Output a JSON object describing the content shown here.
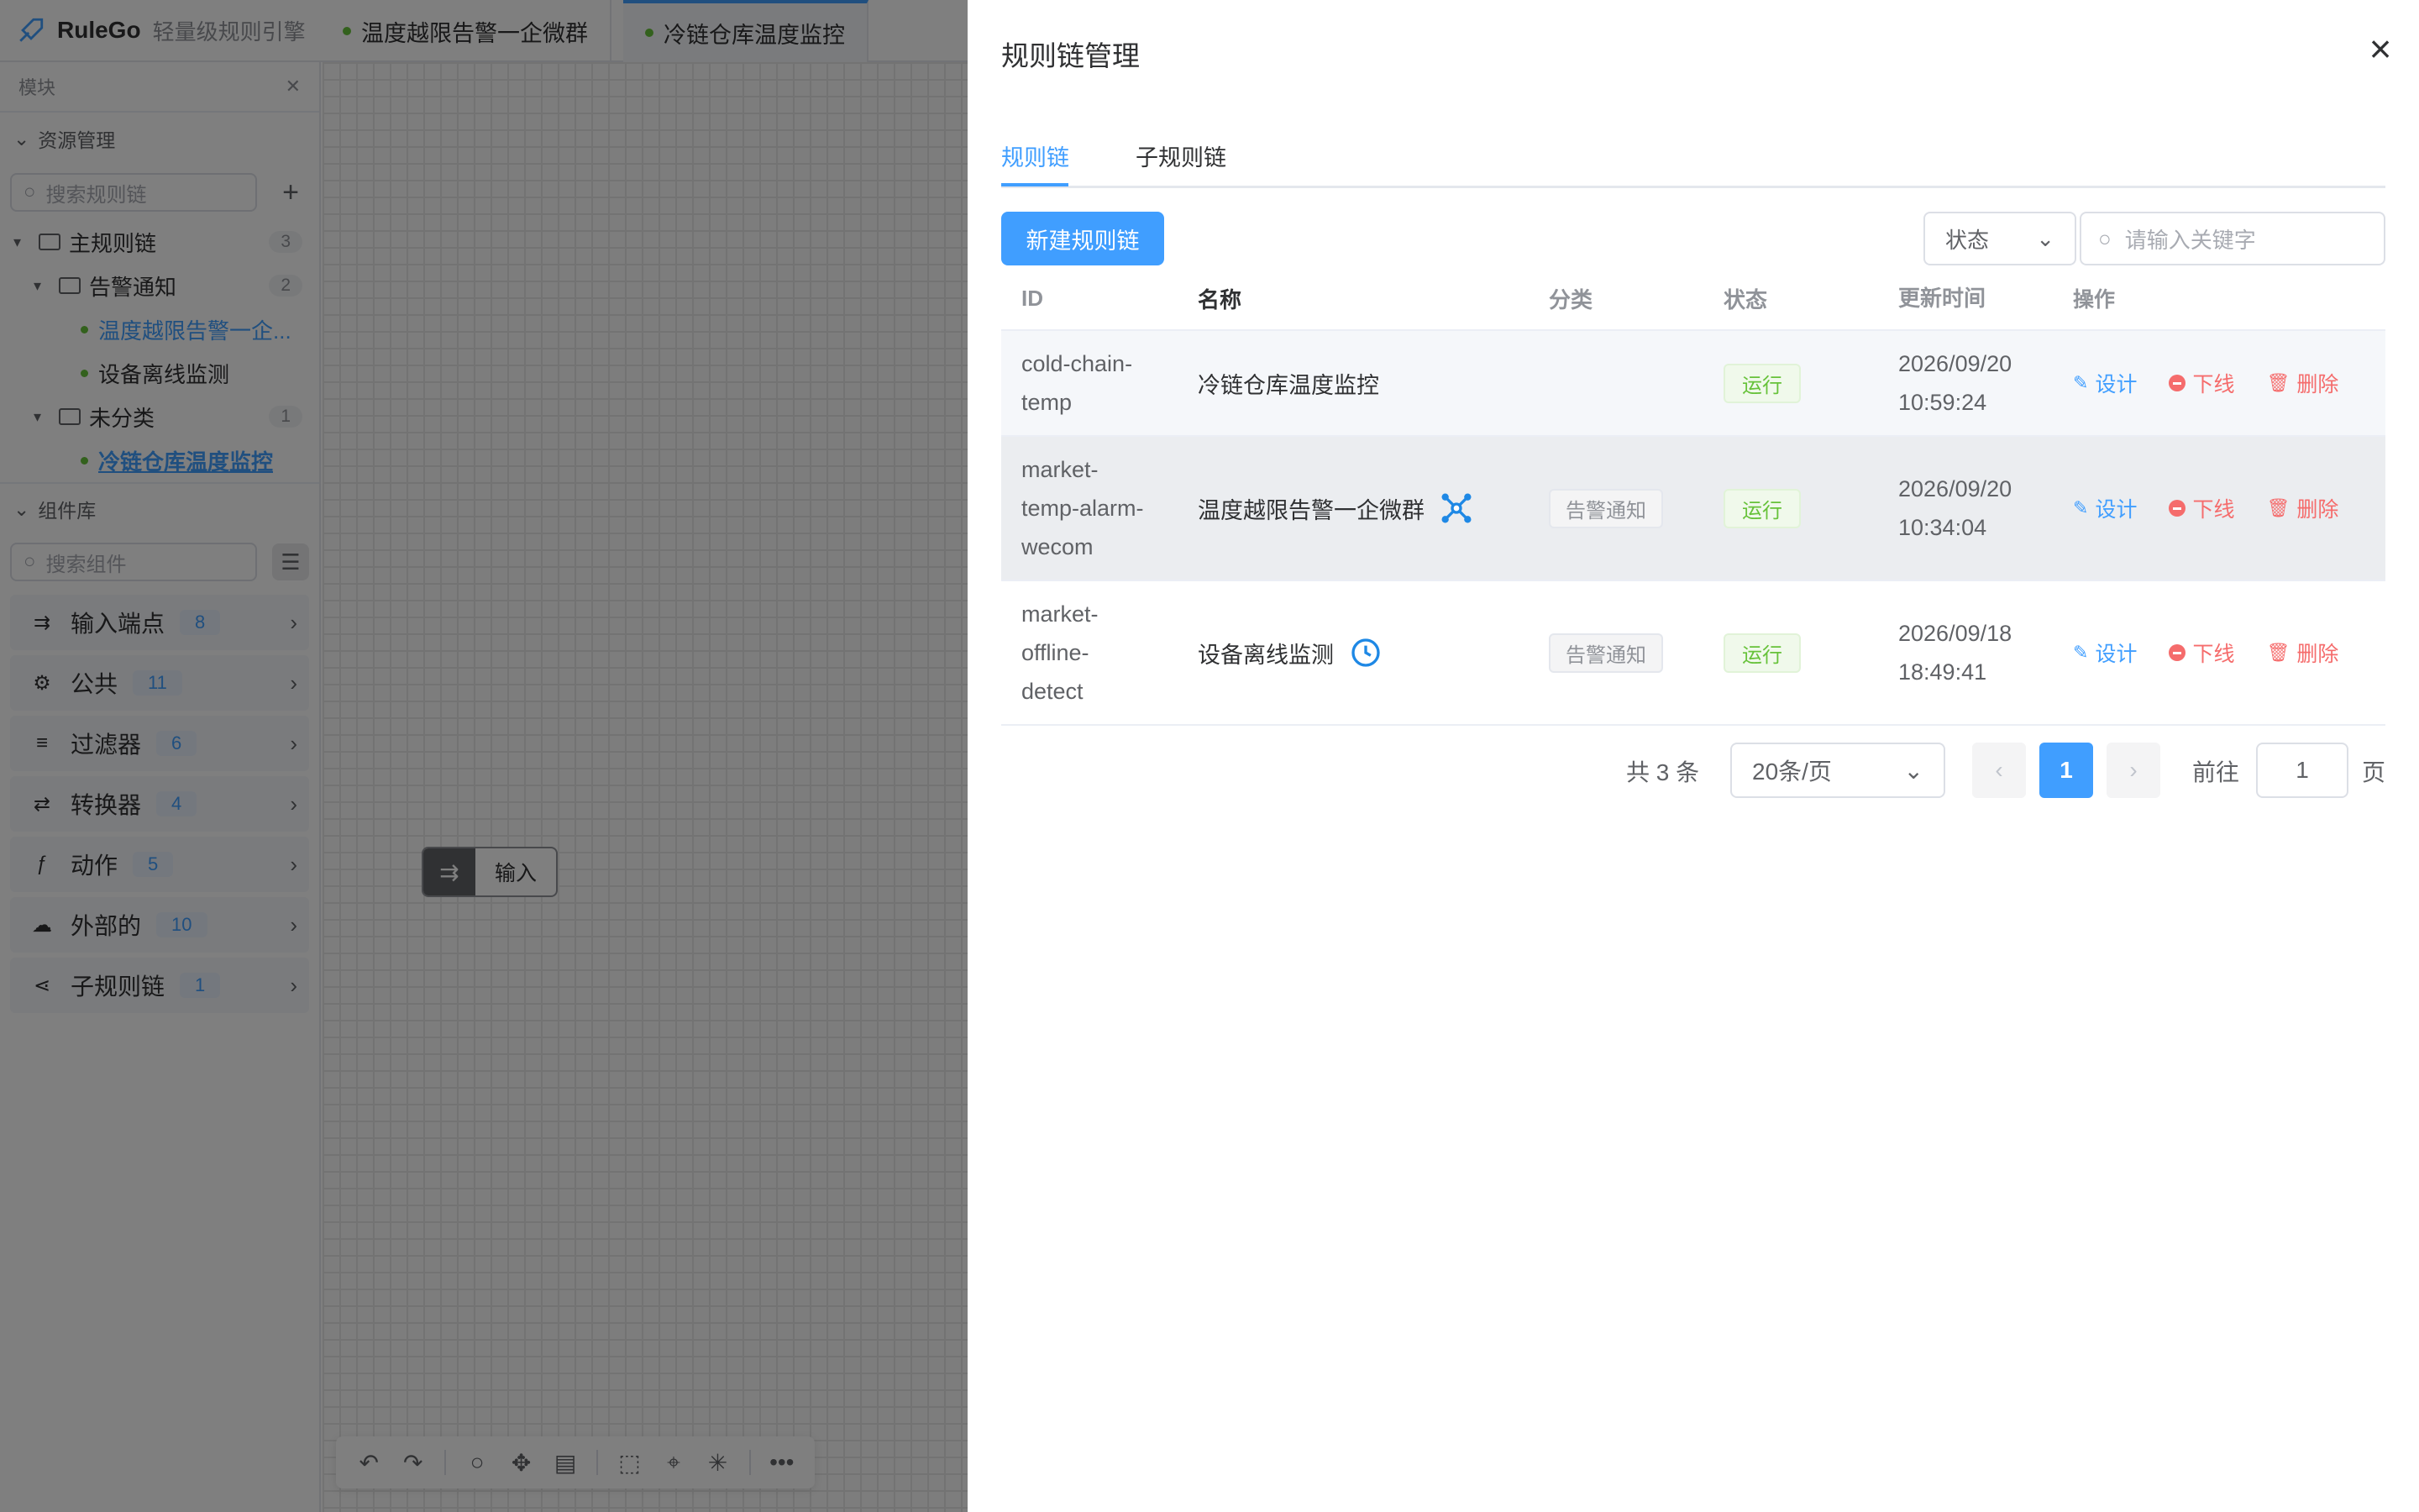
{
  "app": {
    "logo_name": "RuleGo",
    "logo_sub": "轻量级规则引擎",
    "tabs": [
      {
        "label": "温度越限告警一企微群"
      },
      {
        "label": "冷链仓库温度监控"
      }
    ]
  },
  "sidebar": {
    "header": "模块",
    "resources_title": "资源管理",
    "search_chains_placeholder": "搜索规则链",
    "tree": [
      {
        "label": "主规则链",
        "count": "3"
      },
      {
        "label": "告警通知",
        "count": "2"
      },
      {
        "label": "温度越限告警一企..."
      },
      {
        "label": "设备离线监测"
      },
      {
        "label": "未分类",
        "count": "1"
      },
      {
        "label": "冷链仓库温度监控"
      }
    ],
    "components_title": "组件库",
    "search_components_placeholder": "搜索组件",
    "components": [
      {
        "label": "输入端点",
        "count": "8"
      },
      {
        "label": "公共",
        "count": "11"
      },
      {
        "label": "过滤器",
        "count": "6"
      },
      {
        "label": "转换器",
        "count": "4"
      },
      {
        "label": "动作",
        "count": "5"
      },
      {
        "label": "外部的",
        "count": "10"
      },
      {
        "label": "子规则链",
        "count": "1"
      }
    ]
  },
  "canvas": {
    "node_label": "输入"
  },
  "drawer": {
    "title": "规则链管理",
    "tabs": [
      {
        "label": "规则链"
      },
      {
        "label": "子规则链"
      }
    ],
    "new_button": "新建规则链",
    "status_placeholder": "状态",
    "keyword_placeholder": "请输入关键字",
    "columns": [
      "ID",
      "名称",
      "分类",
      "状态",
      "更新时间",
      "操作"
    ],
    "rows": [
      {
        "id_lines": [
          "cold-chain-",
          "temp"
        ],
        "name": "冷链仓库温度监控",
        "category": "",
        "status": "运行",
        "date": "2026/09/20",
        "time": "10:59:24"
      },
      {
        "id_lines": [
          "market-",
          "temp-alarm-",
          "wecom"
        ],
        "name": "温度越限告警一企微群",
        "category": "告警通知",
        "status": "运行",
        "date": "2026/09/20",
        "time": "10:34:04"
      },
      {
        "id_lines": [
          "market-",
          "offline-",
          "detect"
        ],
        "name": "设备离线监测",
        "category": "告警通知",
        "status": "运行",
        "date": "2026/09/18",
        "time": "18:49:41"
      }
    ],
    "ops": {
      "design": "设计",
      "offline": "下线",
      "delete": "删除"
    },
    "pagination": {
      "total": "共 3 条",
      "page_size": "20条/页",
      "current_page": "1",
      "goto_label": "前往",
      "goto_value": "1",
      "page_suffix": "页"
    }
  },
  "colors": {
    "primary": "#409eff",
    "success": "#67c23a",
    "danger": "#f56c6c",
    "network_icon": "#1e88e5",
    "clock_icon": "#1e88e5"
  }
}
